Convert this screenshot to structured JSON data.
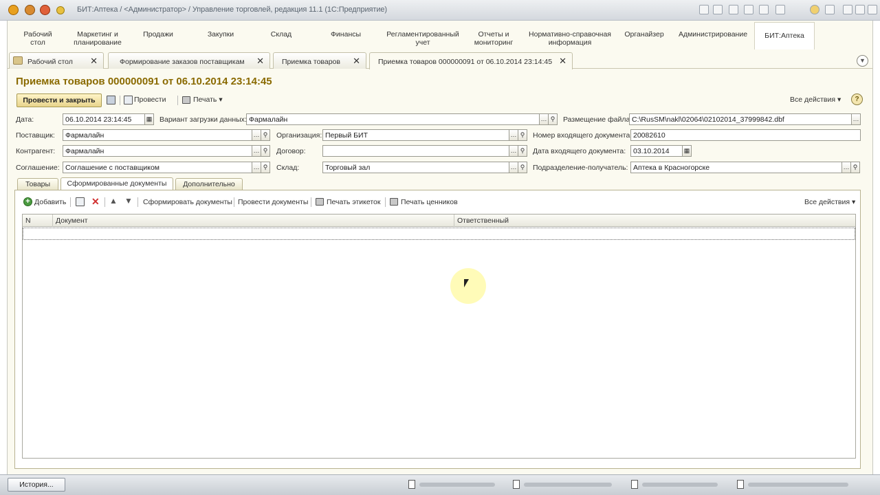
{
  "window": {
    "title": "БИТ:Аптека / <Администратор> / Управление торговлей, редакция 11.1 (1С:Предприятие)"
  },
  "sections": [
    {
      "label": "Рабочий\nстол"
    },
    {
      "label": "Маркетинг и\nпланирование"
    },
    {
      "label": "Продажи"
    },
    {
      "label": "Закупки"
    },
    {
      "label": "Склад"
    },
    {
      "label": "Финансы"
    },
    {
      "label": "Регламентированный\nучет"
    },
    {
      "label": "Отчеты и\nмониторинг"
    },
    {
      "label": "Нормативно-справочная\nинформация"
    },
    {
      "label": "Органайзер"
    },
    {
      "label": "Администрирование"
    },
    {
      "label": "БИТ:Аптека"
    }
  ],
  "open_tabs": [
    {
      "label": "Рабочий стол"
    },
    {
      "label": "Формирование заказов поставщикам"
    },
    {
      "label": "Приемка товаров"
    },
    {
      "label": "Приемка товаров 000000091 от 06.10.2014 23:14:45"
    }
  ],
  "document": {
    "title": "Приемка товаров 000000091 от 06.10.2014 23:14:45"
  },
  "toolbar": {
    "post_close": "Провести и закрыть",
    "post": "Провести",
    "print": "Печать",
    "all_actions": "Все действия"
  },
  "form": {
    "date_label": "Дата:",
    "date_value": "06.10.2014 23:14:45",
    "load_variant_label": "Вариант загрузки данных:",
    "load_variant_value": "Фармалайн",
    "file_location_label": "Размещение файла:",
    "file_location_value": "C:\\RusSM\\nakl\\02064\\02102014_37999842.dbf",
    "supplier_label": "Поставщик:",
    "supplier_value": "Фармалайн",
    "organization_label": "Организация:",
    "organization_value": "Первый БИТ",
    "incoming_number_label": "Номер входящего документа:",
    "incoming_number_value": "20082610",
    "counterparty_label": "Контрагент:",
    "counterparty_value": "Фармалайн",
    "contract_label": "Договор:",
    "contract_value": "",
    "incoming_date_label": "Дата входящего документа:",
    "incoming_date_value": "03.10.2014",
    "agreement_label": "Соглашение:",
    "agreement_value": "Соглашение с поставщиком",
    "warehouse_label": "Склад:",
    "warehouse_value": "Торговый зал",
    "recipient_label": "Подразделение-получатель:",
    "recipient_value": "Аптека в Красногорске"
  },
  "form_tabs": [
    {
      "label": "Товары"
    },
    {
      "label": "Сформированные документы"
    },
    {
      "label": "Дополнительно"
    }
  ],
  "panel_toolbar": {
    "add": "Добавить",
    "generate_docs": "Сформировать документы",
    "post_docs": "Провести документы",
    "print_labels": "Печать этикеток",
    "print_price_tags": "Печать ценников",
    "all_actions": "Все действия"
  },
  "grid": {
    "columns": [
      "N",
      "Документ",
      "Ответственный"
    ]
  },
  "taskbar": {
    "history": "История..."
  }
}
